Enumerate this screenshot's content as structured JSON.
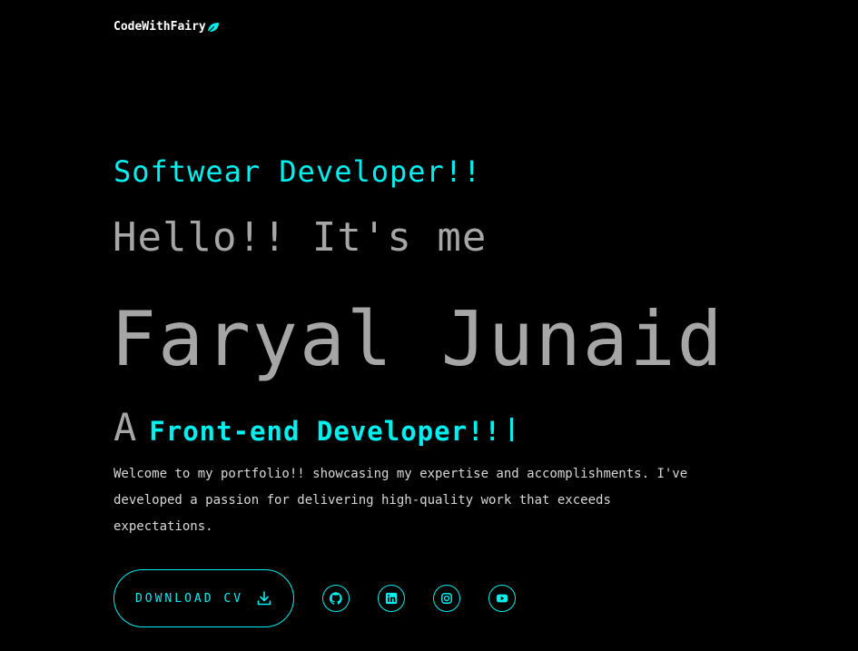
{
  "header": {
    "logo_text": "CodeWithFairy",
    "logo_icon": "leaf-icon"
  },
  "hero": {
    "subtitle": "Softwear Developer!!",
    "greeting": "Hello!! It's me",
    "name": "Faryal Junaid",
    "role_prefix": "A",
    "role_text": "Front-end Developer!!",
    "intro": "Welcome to my portfolio!! showcasing my expertise and accomplishments. I've developed a passion for delivering high-quality work that exceeds expectations."
  },
  "actions": {
    "download_label": "DOWNLOAD CV",
    "download_icon": "download-icon"
  },
  "socials": [
    {
      "icon": "github-icon"
    },
    {
      "icon": "linkedin-icon"
    },
    {
      "icon": "instagram-icon"
    },
    {
      "icon": "youtube-icon"
    }
  ],
  "colors": {
    "accent": "#00efef",
    "background": "#000000",
    "text_muted": "#a6a6a6",
    "text_body": "#d8d8d8"
  }
}
